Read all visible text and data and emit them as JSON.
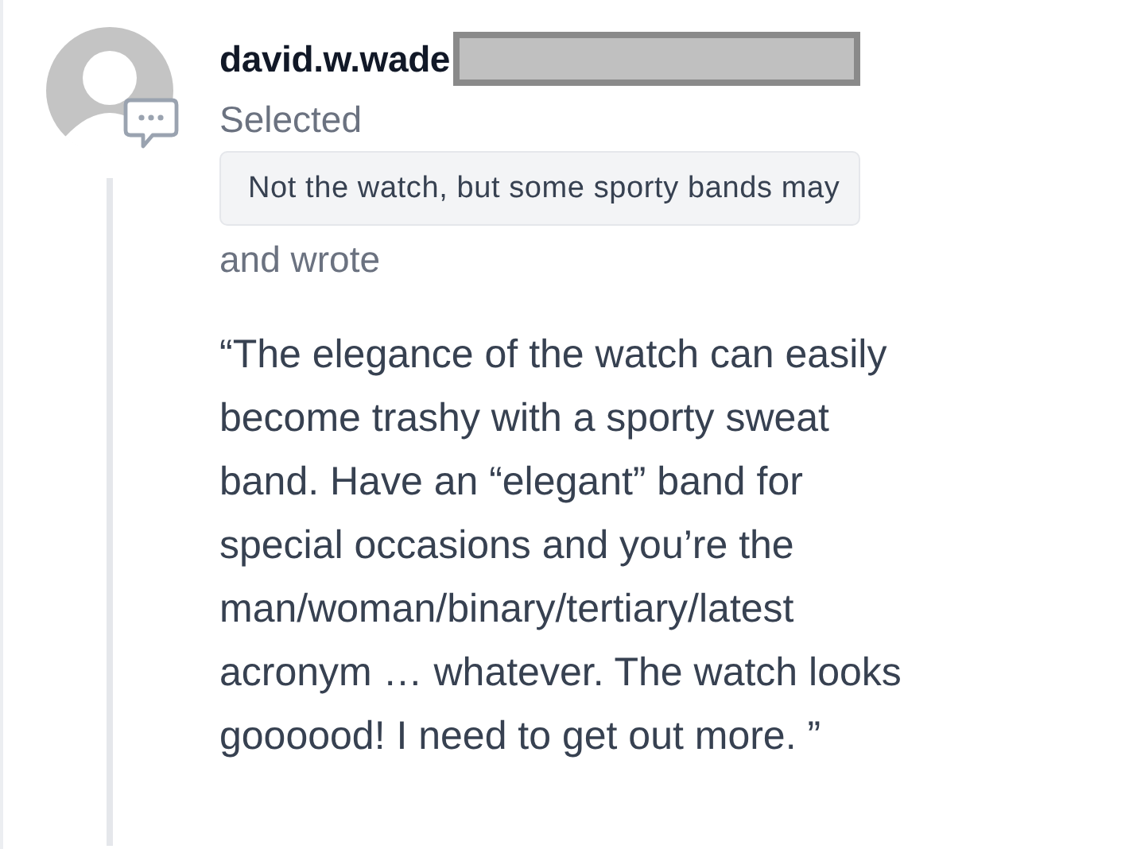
{
  "comment": {
    "author": "david.w.wade",
    "author_redacted": true,
    "action": "Selected",
    "selection": "Not the watch, but some sporty bands may",
    "connector": "and wrote",
    "quote": "“The elegance of the watch can easily\nbecome trashy with a sporty sweat\nband. Have an “elegant” band for\nspecial occasions and you’re the\nman/woman/binary/tertiary/latest\nacronym … whatever. The watch looks\ngoooood! I need to get out more. ”"
  }
}
